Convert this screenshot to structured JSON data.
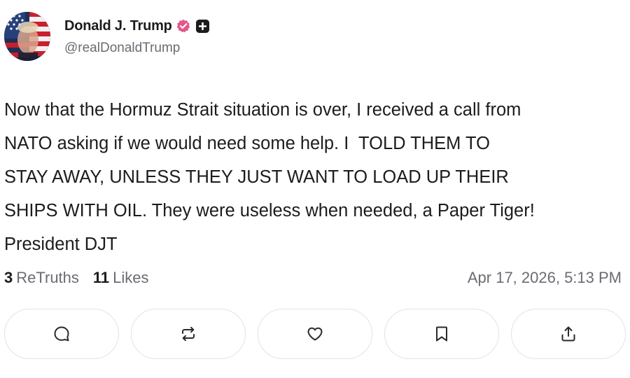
{
  "post": {
    "author": {
      "display_name": "Donald J. Trump",
      "handle": "@realDonaldTrump",
      "avatar_icon": "avatar-flag-portrait",
      "verified_icon": "verified-badge-icon",
      "verified_color": "#e5568a",
      "secondary_badge_icon": "truth-social-badge-icon"
    },
    "content": "Now that the Hormuz Strait situation is over, I received a call from\nNATO asking if we would need some help. I  TOLD THEM TO\nSTAY AWAY, UNLESS THEY JUST WANT TO LOAD UP THEIR\nSHIPS WITH OIL. They were useless when needed, a Paper Tiger!\nPresident DJT",
    "stats": {
      "retruths_count": "3",
      "retruths_label": "ReTruths",
      "likes_count": "11",
      "likes_label": "Likes"
    },
    "timestamp": "Apr 17, 2026, 5:13 PM",
    "actions": [
      {
        "name": "reply",
        "icon": "comment-icon"
      },
      {
        "name": "retruth",
        "icon": "repost-icon"
      },
      {
        "name": "like",
        "icon": "heart-icon"
      },
      {
        "name": "bookmark",
        "icon": "bookmark-icon"
      },
      {
        "name": "share",
        "icon": "share-icon"
      }
    ]
  },
  "colors": {
    "text_primary": "#1c1c1e",
    "text_secondary": "#6b6b73",
    "border": "#e3e3e8",
    "icon": "#2a2a2e"
  }
}
